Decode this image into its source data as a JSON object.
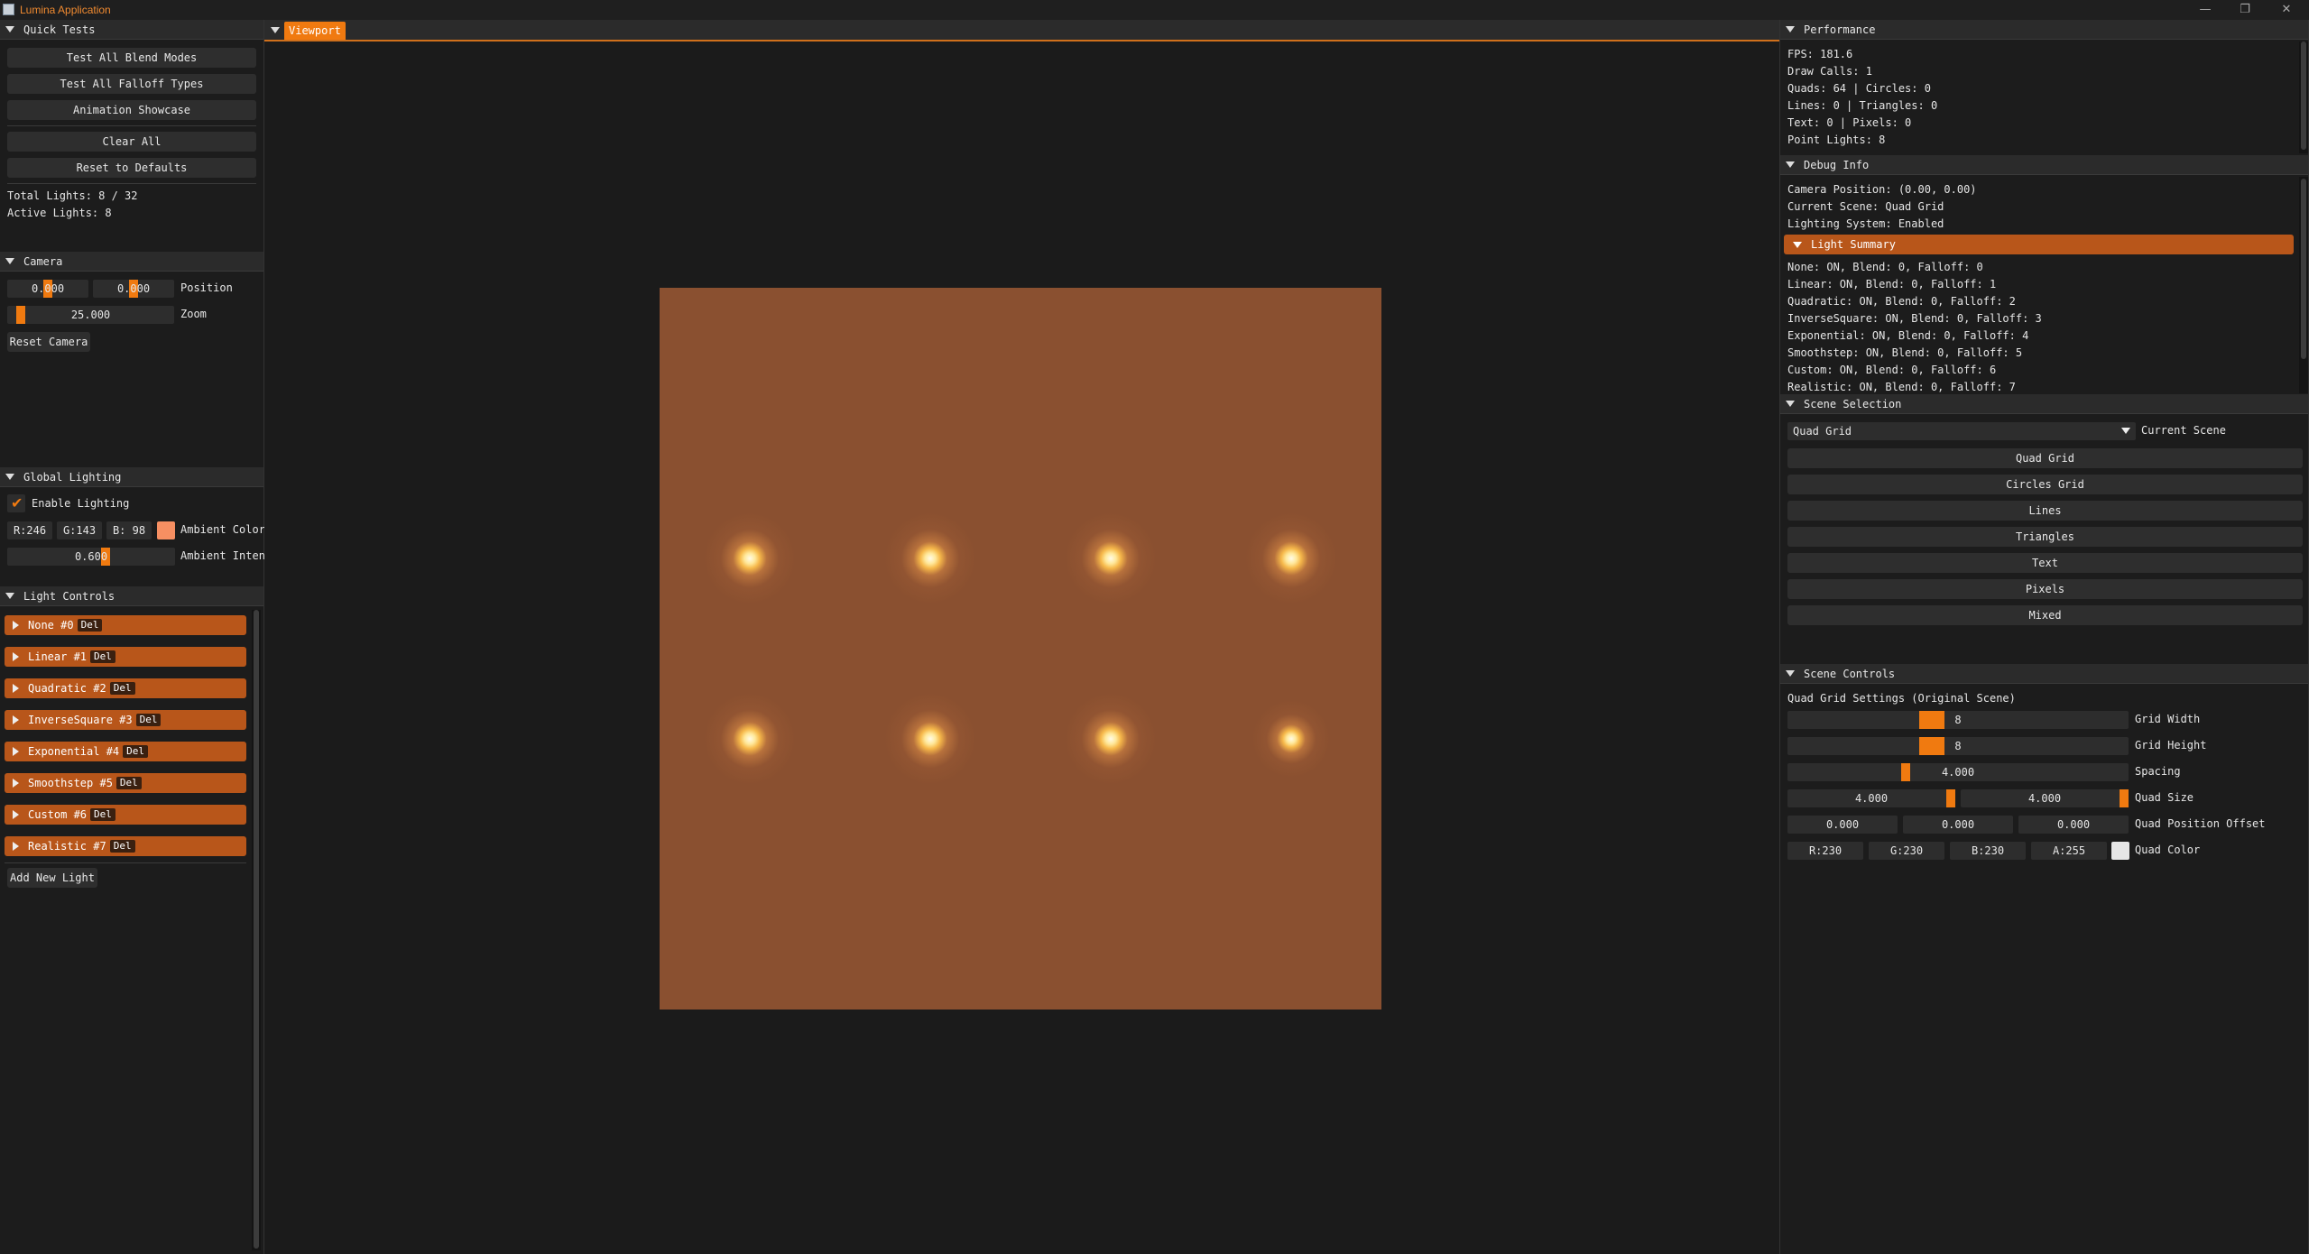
{
  "window": {
    "title": "Lumina Application",
    "minimize": "—",
    "restore": "❐",
    "close": "✕"
  },
  "quick_tests": {
    "header": "Quick Tests",
    "buttons": [
      "Test All Blend Modes",
      "Test All Falloff Types",
      "Animation Showcase",
      "Clear All",
      "Reset to Defaults"
    ],
    "total_lights": "Total Lights: 8 / 32",
    "active_lights": "Active Lights: 8"
  },
  "camera": {
    "header": "Camera",
    "pos_x": "0.000",
    "pos_y": "0.000",
    "position_label": "Position",
    "zoom": "25.000",
    "zoom_label": "Zoom",
    "reset": "Reset Camera"
  },
  "global_lighting": {
    "header": "Global Lighting",
    "enable_label": "Enable Lighting",
    "r": "R:246",
    "g": "G:143",
    "b": "B: 98",
    "ambient_color_label": "Ambient Color",
    "ambient_color": "#f68f62",
    "intensity": "0.600",
    "intensity_label": "Ambient Inten"
  },
  "light_controls": {
    "header": "Light Controls",
    "items": [
      {
        "label": "None #0"
      },
      {
        "label": "Linear #1"
      },
      {
        "label": "Quadratic #2"
      },
      {
        "label": "InverseSquare #3"
      },
      {
        "label": "Exponential #4"
      },
      {
        "label": "Smoothstep #5"
      },
      {
        "label": "Custom #6"
      },
      {
        "label": "Realistic #7"
      }
    ],
    "del_label": "Del",
    "add": "Add New Light"
  },
  "viewport": {
    "tab": "Viewport",
    "quad_color": "#8a5030"
  },
  "performance": {
    "header": "Performance",
    "lines": [
      "FPS: 181.6",
      "Draw Calls: 1",
      "Quads: 64 | Circles: 0",
      "Lines: 0 | Triangles: 0",
      "Text: 0 | Pixels: 0",
      "Point Lights: 8"
    ]
  },
  "debug_info": {
    "header": "Debug Info",
    "lines": [
      "Camera Position: (0.00, 0.00)",
      "Current Scene: Quad Grid",
      "Lighting System: Enabled"
    ],
    "summary_header": "Light Summary",
    "summary": [
      "None: ON, Blend: 0, Falloff: 0",
      "Linear: ON, Blend: 0, Falloff: 1",
      "Quadratic: ON, Blend: 0, Falloff: 2",
      "InverseSquare: ON, Blend: 0, Falloff: 3",
      "Exponential: ON, Blend: 0, Falloff: 4",
      "Smoothstep: ON, Blend: 0, Falloff: 5",
      "Custom: ON, Blend: 0, Falloff: 6",
      "Realistic: ON, Blend: 0, Falloff: 7"
    ]
  },
  "scene_selection": {
    "header": "Scene Selection",
    "current": "Quad Grid",
    "current_label": "Current Scene",
    "buttons": [
      "Quad Grid",
      "Circles Grid",
      "Lines",
      "Triangles",
      "Text",
      "Pixels",
      "Mixed"
    ]
  },
  "scene_controls": {
    "header": "Scene Controls",
    "subtitle": "Quad Grid Settings (Original Scene)",
    "grid_width": "8",
    "grid_width_label": "Grid Width",
    "grid_height": "8",
    "grid_height_label": "Grid Height",
    "spacing": "4.000",
    "spacing_label": "Spacing",
    "quad_w": "4.000",
    "quad_h": "4.000",
    "quad_size_label": "Quad Size",
    "off_x": "0.000",
    "off_y": "0.000",
    "off_z": "0.000",
    "offset_label": "Quad Position Offset",
    "r": "R:230",
    "g": "G:230",
    "b": "B:230",
    "a": "A:255",
    "color_label": "Quad Color",
    "quad_color": "#e6e6e6"
  }
}
